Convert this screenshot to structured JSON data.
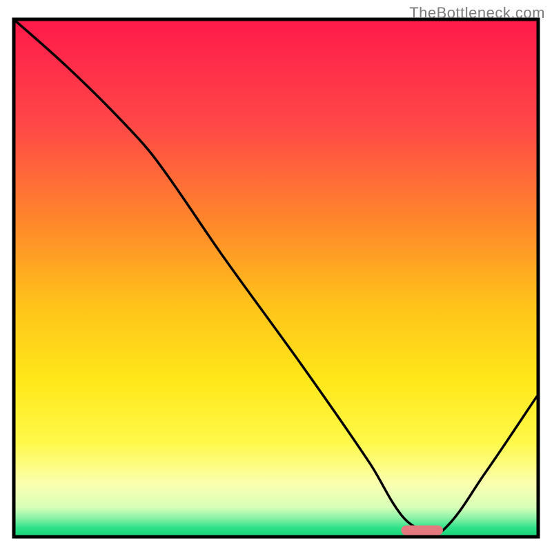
{
  "watermark": "TheBottleneck.com",
  "chart_data": {
    "type": "line",
    "title": "",
    "xlabel": "",
    "ylabel": "",
    "xlim": [
      0,
      100
    ],
    "ylim": [
      0,
      100
    ],
    "grid": false,
    "legend": false,
    "series": [
      {
        "name": "curve",
        "x": [
          0,
          10,
          20,
          27,
          40,
          55,
          68,
          74,
          78,
          82,
          90,
          100
        ],
        "y": [
          100,
          91,
          81,
          73,
          54,
          33,
          14,
          4,
          1,
          1,
          12,
          27
        ]
      }
    ],
    "marker": {
      "name": "optimal-region",
      "x_start": 74,
      "x_end": 82,
      "y": 1,
      "color": "#e47a80"
    },
    "background_gradient": {
      "stops": [
        {
          "offset": 0.0,
          "color": "#ff1a4b"
        },
        {
          "offset": 0.2,
          "color": "#ff4747"
        },
        {
          "offset": 0.4,
          "color": "#ff8a2a"
        },
        {
          "offset": 0.55,
          "color": "#ffc21a"
        },
        {
          "offset": 0.7,
          "color": "#ffe81a"
        },
        {
          "offset": 0.82,
          "color": "#fff94a"
        },
        {
          "offset": 0.9,
          "color": "#faffb0"
        },
        {
          "offset": 0.945,
          "color": "#d9ffb8"
        },
        {
          "offset": 0.965,
          "color": "#8ff2a8"
        },
        {
          "offset": 0.985,
          "color": "#2fe28a"
        },
        {
          "offset": 1.0,
          "color": "#18d67a"
        }
      ]
    },
    "frame": {
      "stroke": "#000000",
      "stroke_width": 4
    }
  }
}
